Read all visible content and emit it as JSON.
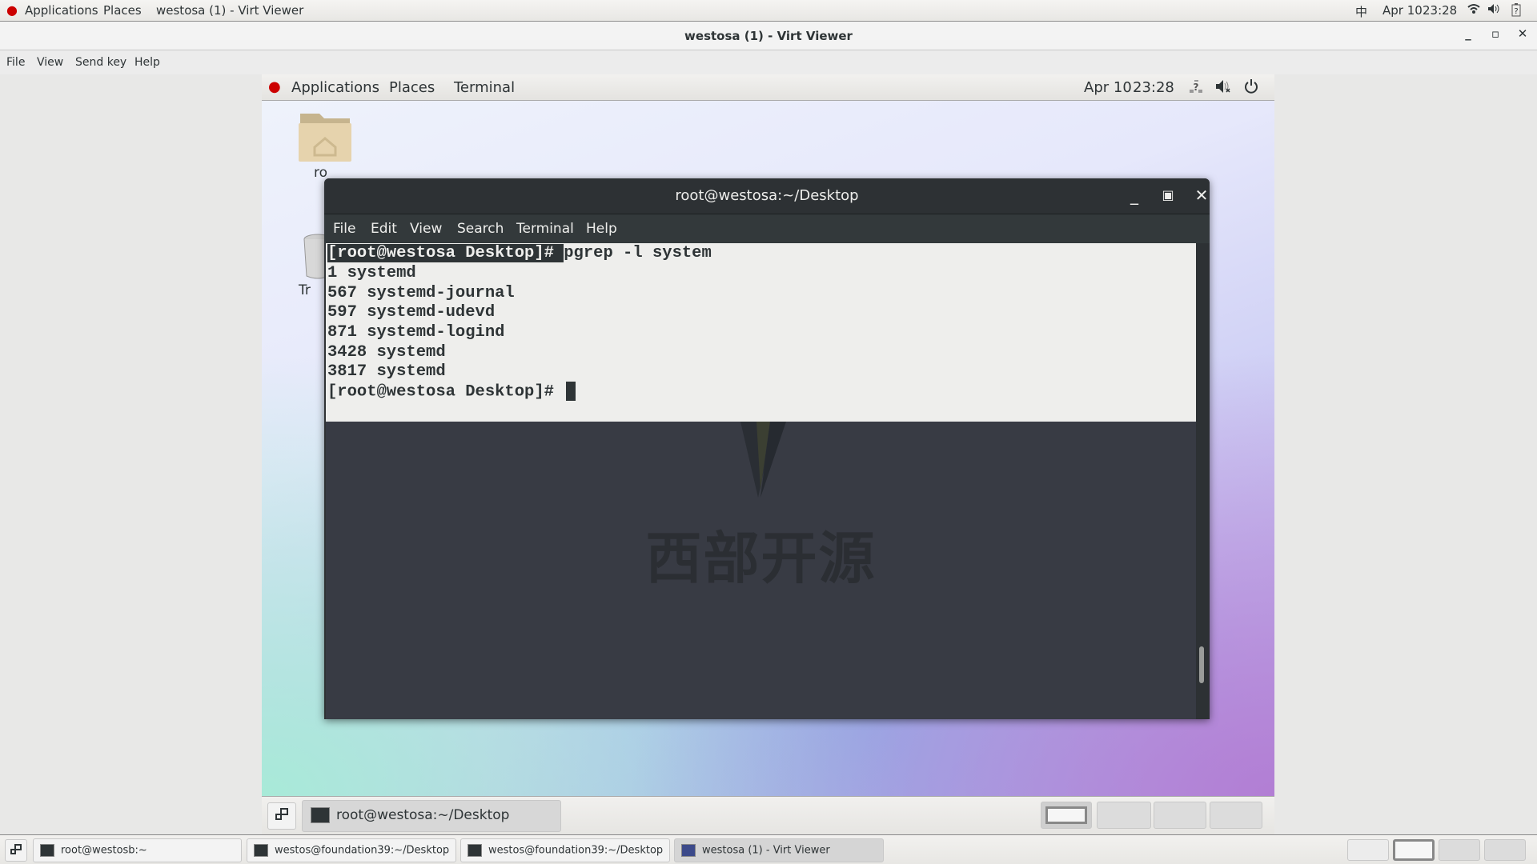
{
  "host_topbar": {
    "applications": "Applications",
    "places": "Places",
    "window_title": "westosa (1) - Virt Viewer",
    "input_method": "中",
    "date": "Apr 10",
    "time": "23:28",
    "icons": [
      "redhat-logo-icon",
      "wifi-icon",
      "volume-icon",
      "battery-unknown-icon"
    ]
  },
  "virt_viewer": {
    "title": "westosa (1) - Virt Viewer",
    "window_buttons": {
      "minimize": "_",
      "maximize": "▫",
      "close": "✕"
    },
    "menu": [
      "File",
      "View",
      "Send key",
      "Help"
    ]
  },
  "guest": {
    "topbar": {
      "applications": "Applications",
      "places": "Places",
      "terminal": "Terminal",
      "date": "Apr 10",
      "time": "23:28",
      "icons": [
        "network-unknown-icon",
        "volume-muted-icon",
        "power-icon"
      ]
    },
    "desktop_icons": [
      {
        "label": "ro",
        "icon": "home-folder-icon"
      },
      {
        "label": "Tr",
        "icon": "trash-icon"
      }
    ],
    "terminal": {
      "title": "root@westosa:~/Desktop",
      "menu": [
        "File",
        "Edit",
        "View",
        "Search",
        "Terminal",
        "Help"
      ],
      "prompt": "[root@westosa Desktop]# ",
      "command": "pgrep -l system",
      "output": [
        "1 systemd",
        "567 systemd-journal",
        "597 systemd-udevd",
        "871 systemd-logind",
        "3428 systemd",
        "3817 systemd"
      ],
      "watermark": "西部开源"
    },
    "taskbar": {
      "window_label": "root@westosa:~/Desktop",
      "workspaces": 4,
      "active_workspace": 1
    }
  },
  "host_taskbar": {
    "windows": [
      {
        "label": "root@westosb:~",
        "active": false
      },
      {
        "label": "westos@foundation39:~/Desktop",
        "active": false
      },
      {
        "label": "westos@foundation39:~/Desktop",
        "active": false
      },
      {
        "label": "westosa (1) - Virt Viewer",
        "active": true
      }
    ],
    "workspaces": 4,
    "active_workspace": 2
  }
}
